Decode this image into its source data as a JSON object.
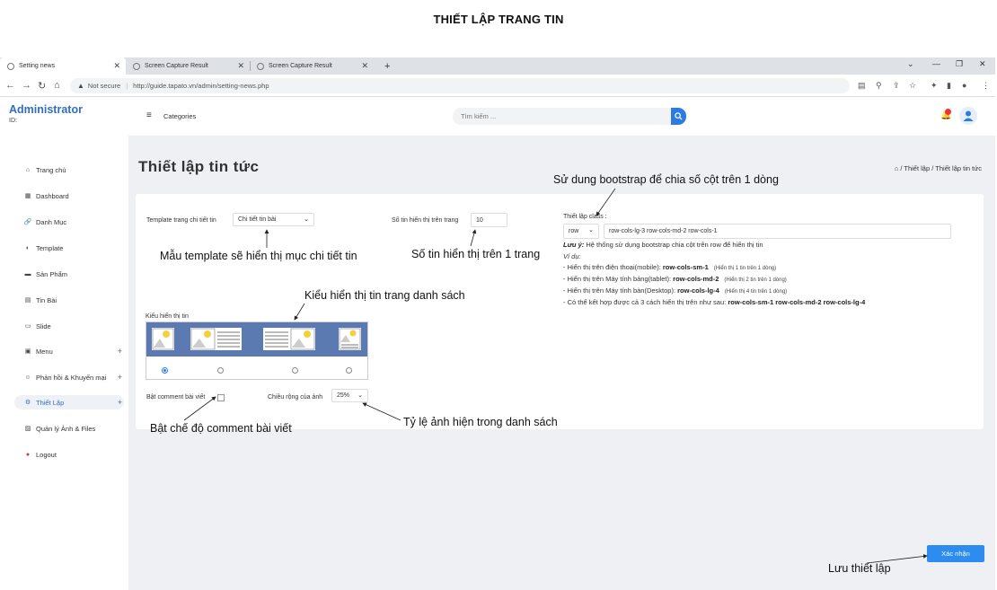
{
  "doc_title": "THIẾT LẬP  TRANG TIN",
  "browser": {
    "tabs": [
      {
        "label": "Setting news",
        "close": "✕"
      },
      {
        "label": "Screen Capture Result",
        "close": "✕"
      },
      {
        "label": "Screen Capture Result",
        "close": "✕"
      }
    ],
    "new_tab": "+",
    "not_secure": "Not secure",
    "url": "http://guide.tapato.vn/admin/setting-news.php"
  },
  "brand": {
    "name": "Administrator",
    "id_label": "ID:"
  },
  "sidebar": {
    "items": [
      {
        "label": "Trang chủ",
        "icon": "⌂"
      },
      {
        "label": "Dashboard",
        "icon": "▦"
      },
      {
        "label": "Danh Mục",
        "icon": "🔗"
      },
      {
        "label": "Template",
        "icon": "◐"
      },
      {
        "label": "Sản Phẩm",
        "icon": "▬"
      },
      {
        "label": "Tin Bài",
        "icon": "▤"
      },
      {
        "label": "Slide",
        "icon": "▭"
      },
      {
        "label": "Menu",
        "icon": "▣",
        "plus": "+"
      },
      {
        "label": "Phản hồi & Khuyến mại",
        "icon": "☺",
        "plus": "+"
      },
      {
        "label": "Thiết Lập",
        "icon": "⚙",
        "plus": "+"
      },
      {
        "label": "Quản lý Ảnh & Files",
        "icon": "▨"
      },
      {
        "label": "Logout",
        "icon": "●"
      }
    ]
  },
  "topnav": {
    "categories": "Categories",
    "search_placeholder": "Tìm kiếm ..."
  },
  "page": {
    "title": "Thiết lập tin tức",
    "breadcrumb_home": "⌂",
    "breadcrumb": [
      "Thiết lập",
      "Thiết lập tin tức"
    ],
    "breadcrumb_sep": "/"
  },
  "form": {
    "template_label": "Template trang chi tiết tin",
    "template_value": "Chi tiết tin bài",
    "news_per_page_label": "Số tin hiển thị trên trang",
    "news_per_page_value": "10",
    "layout_label": "Kiểu hiển thị tin",
    "comment_label": "Bật comment bài viết",
    "image_width_label": "Chiều rộng của ảnh",
    "image_width_value": "25%",
    "class_label": "Thiết lập class :",
    "class_prefix": "row",
    "class_value": "row-cols-lg-3  row-cols-md-2 row-cols-1",
    "note_title": "Lưu ý:",
    "note_text": " Hệ thống sử dụng bootstrap chia cột trên row để hiển thị tin",
    "example_title": "Ví dụ:",
    "examples": [
      {
        "text": "- Hiển thị trên điện thoại(mobile): ",
        "code": "row-cols-sm-1",
        "hint": "(Hiển thị 1 tin trên 1 dòng)"
      },
      {
        "text": "- Hiển thị trên Máy tính bảng(tablet): ",
        "code": "row-cols-md-2",
        "hint": "(Hiển thị 2 tin trên 1 dòng)"
      },
      {
        "text": "- Hiển thị trên Máy tính bàn(Desktop): ",
        "code": "row-cols-lg-4",
        "hint": "(Hiển thị 4 tin trên 1 dòng)"
      },
      {
        "text": "- Có thể kết hợp được cả 3 cách hiển thị trên như sau: ",
        "code": "row-cols-sm-1 row-cols-md-2 row-cols-lg-4",
        "hint": ""
      }
    ],
    "save_label": "Xác nhận"
  },
  "annotations": {
    "bootstrap": "Sử dung bootstrap để chia số cột trên 1 dòng",
    "template": "Mẫu template sẽ hiển thị mục chi tiết tin",
    "news_count": "Số tin hiển thị trên 1 trang",
    "layout": "Kiểu hiển thị tin trang danh sách",
    "comment": "Bật chế độ comment bài viết",
    "ratio": "Tỷ lệ ảnh hiện trong danh sách",
    "save": "Lưu thiết lập"
  },
  "colors": {
    "accent": "#2c7be5",
    "brand": "#2f6fbf",
    "layout_strip": "#5b7ab2",
    "content_bg": "#eef0f3"
  }
}
